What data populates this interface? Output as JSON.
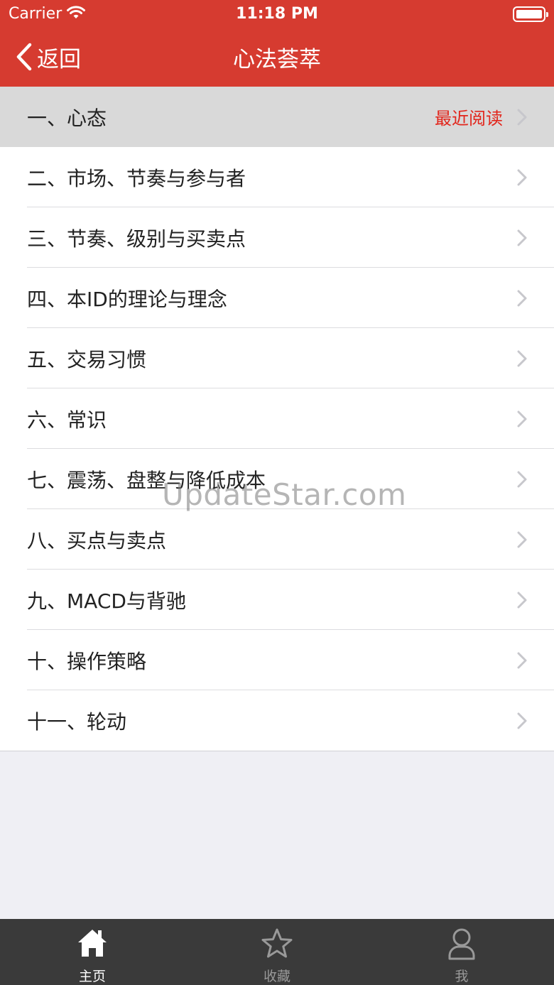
{
  "status_bar": {
    "carrier": "Carrier",
    "time": "11:18 PM"
  },
  "nav": {
    "back_label": "返回",
    "title": "心法荟萃",
    "background": "#d63b30"
  },
  "list": {
    "recent_label": "最近阅读",
    "items": [
      {
        "label": "一、心态"
      },
      {
        "label": "二、市场、节奏与参与者"
      },
      {
        "label": "三、节奏、级别与买卖点"
      },
      {
        "label": "四、本ID的理论与理念"
      },
      {
        "label": "五、交易习惯"
      },
      {
        "label": "六、常识"
      },
      {
        "label": "七、震荡、盘整与降低成本"
      },
      {
        "label": "八、买点与卖点"
      },
      {
        "label": "九、MACD与背驰"
      },
      {
        "label": "十、操作策略"
      },
      {
        "label": "十一、轮动"
      }
    ]
  },
  "watermark": "UpdateStar.com",
  "tabbar": {
    "tabs": [
      {
        "label": "主页",
        "icon": "home-icon",
        "active": true
      },
      {
        "label": "收藏",
        "icon": "star-icon",
        "active": false
      },
      {
        "label": "我",
        "icon": "person-icon",
        "active": false
      }
    ]
  }
}
